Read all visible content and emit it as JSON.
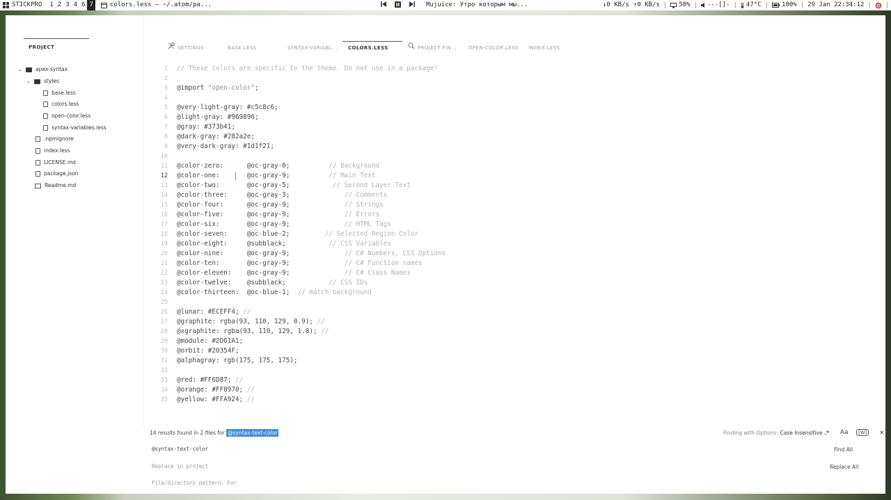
{
  "topbar": {
    "wm_label": "STICKPRO",
    "workspaces": [
      "1",
      "2",
      "3",
      "4",
      "6",
      "7"
    ],
    "active_workspace": "7",
    "window_title": "colors.less — ~/.atom/pa...",
    "now_playing": "Mujuice: Утро которым мы...",
    "down_speed": "↓0 KB/s",
    "up_speed": "↑0 KB/s",
    "memory": "50%",
    "volume": "---[]-",
    "temp": "47°C",
    "battery": "100%",
    "datetime": "29 Jan 22:34:12",
    "colors": {
      "chrome_icon": "#e04a3a",
      "check_icon": "#3cb043"
    }
  },
  "sidebar": {
    "title": "PROJECT",
    "items": [
      {
        "label": "apex-syntax",
        "type": "folder",
        "depth": 0
      },
      {
        "label": "styles",
        "type": "folder",
        "depth": 1
      },
      {
        "label": "base.less",
        "type": "file",
        "depth": 2
      },
      {
        "label": "colors.less",
        "type": "file",
        "depth": 2
      },
      {
        "label": "open-color.less",
        "type": "file",
        "depth": 2
      },
      {
        "label": "syntax-variables.less",
        "type": "file",
        "depth": 2
      },
      {
        "label": ".npmignore",
        "type": "file",
        "depth": 1
      },
      {
        "label": "index.less",
        "type": "file",
        "depth": 1
      },
      {
        "label": "LICENSE.md",
        "type": "file",
        "depth": 1
      },
      {
        "label": "package.json",
        "type": "file",
        "depth": 1
      },
      {
        "label": "Readme.md",
        "type": "book",
        "depth": 1
      }
    ]
  },
  "tabs": [
    {
      "label": "SETTINGS",
      "icon": "wrench-icon"
    },
    {
      "label": "BASE.LESS"
    },
    {
      "label": "SYNTAX-VARIABL..."
    },
    {
      "label": "COLORS.LESS",
      "active": true
    },
    {
      "label": "PROJECT FIN...",
      "icon": "search-icon"
    },
    {
      "label": "OPEN-COLOR.LESS",
      "italic": true
    },
    {
      "label": "INDEX.LESS"
    }
  ],
  "editor": {
    "current_line": "12",
    "lines": [
      {
        "n": "1",
        "code": "",
        "comment": "// These colors are specific to the theme. Do not use in a package!"
      },
      {
        "n": "2",
        "code": "",
        "comment": ""
      },
      {
        "n": "3",
        "code": "@import ",
        "string": "\"open-color\"",
        "tail": ";"
      },
      {
        "n": "4",
        "code": "",
        "comment": ""
      },
      {
        "n": "5",
        "code": "@very-light-gray: #c5c8c6;",
        "comment": ""
      },
      {
        "n": "6",
        "code": "@light-gray: #969896;",
        "comment": ""
      },
      {
        "n": "7",
        "code": "@gray: #373b41;",
        "comment": ""
      },
      {
        "n": "8",
        "code": "@dark-gray: #282a2e;",
        "comment": ""
      },
      {
        "n": "9",
        "code": "@very-dark-gray: #1d1f21;",
        "comment": ""
      },
      {
        "n": "10",
        "code": "",
        "comment": ""
      },
      {
        "n": "11",
        "code": "@color-zero:      @oc-gray-0;          ",
        "comment": "// Background"
      },
      {
        "n": "12",
        "code": "@color-one:       @oc-gray-9;          ",
        "comment": "// Main Text"
      },
      {
        "n": "13",
        "code": "@color-two:       @oc-gray-5;           ",
        "comment": "// Second Layer Text"
      },
      {
        "n": "14",
        "code": "@color-three:     @oc-gray-3;              ",
        "comment": "// Comments"
      },
      {
        "n": "15",
        "code": "@color-four:      @oc-gray-9;              ",
        "comment": "// Strings"
      },
      {
        "n": "16",
        "code": "@color-five:      @oc-gray-9;              ",
        "comment": "// Errors"
      },
      {
        "n": "17",
        "code": "@color-six:       @oc-gray-9;              ",
        "comment": "// HTML Tags"
      },
      {
        "n": "18",
        "code": "@color-seven:     @oc-blue-2;         ",
        "comment": "// Selected Region Color"
      },
      {
        "n": "19",
        "code": "@color-eight:     @subblack;           ",
        "comment": "// CSS Variables"
      },
      {
        "n": "20",
        "code": "@color-nine:      @oc-gray-9;              ",
        "comment": "// C# Numbers, CSS Options"
      },
      {
        "n": "21",
        "code": "@color-ten:       @oc-gray-9;              ",
        "comment": "// C# Function names"
      },
      {
        "n": "22",
        "code": "@color-eleven:    @oc-gray-9;              ",
        "comment": "// C# Class Names"
      },
      {
        "n": "23",
        "code": "@color-twelve:    @subblack;           ",
        "comment": "// CSS IDs"
      },
      {
        "n": "24",
        "code": "@color-thirteen:  @oc-blue-1;  ",
        "comment": "// match background"
      },
      {
        "n": "25",
        "code": "",
        "comment": ""
      },
      {
        "n": "26",
        "code": "@lunar: #ECEFF4; ",
        "comment": "//"
      },
      {
        "n": "27",
        "code": "@graphite: rgba(93, 110, 129, 0.9); ",
        "comment": "//"
      },
      {
        "n": "28",
        "code": "@xgraphite: rgba(93, 110, 129, 1.0); ",
        "comment": "//"
      },
      {
        "n": "29",
        "code": "@module: #2D61A1;",
        "comment": ""
      },
      {
        "n": "30",
        "code": "@orbit: #20354F;",
        "comment": ""
      },
      {
        "n": "31",
        "code": "@alphagray: rgb(175, 175, 175);",
        "comment": ""
      },
      {
        "n": "32",
        "code": "",
        "comment": ""
      },
      {
        "n": "33",
        "code": "@red: #FF6D87; ",
        "comment": "//"
      },
      {
        "n": "34",
        "code": "@orange: #FF8970; ",
        "comment": "//"
      },
      {
        "n": "35",
        "code": "@yellow: #FFA924; ",
        "comment": "//"
      }
    ]
  },
  "find_panel": {
    "results_prefix": "14 results found in 2 files for",
    "results_query": "@syntax-text-color",
    "options_label": "Finding with Options:",
    "options_value": "Case Insensitive",
    "regex_label": ".*",
    "case_label": "Aa",
    "word_label": "[W]",
    "close_label": "✕",
    "find_value": "@syntax-text-color",
    "find_all": "Find All",
    "replace_placeholder": "Replace in project",
    "replace_all": "Replace All",
    "pattern_placeholder": "File/directory pattern: For"
  }
}
